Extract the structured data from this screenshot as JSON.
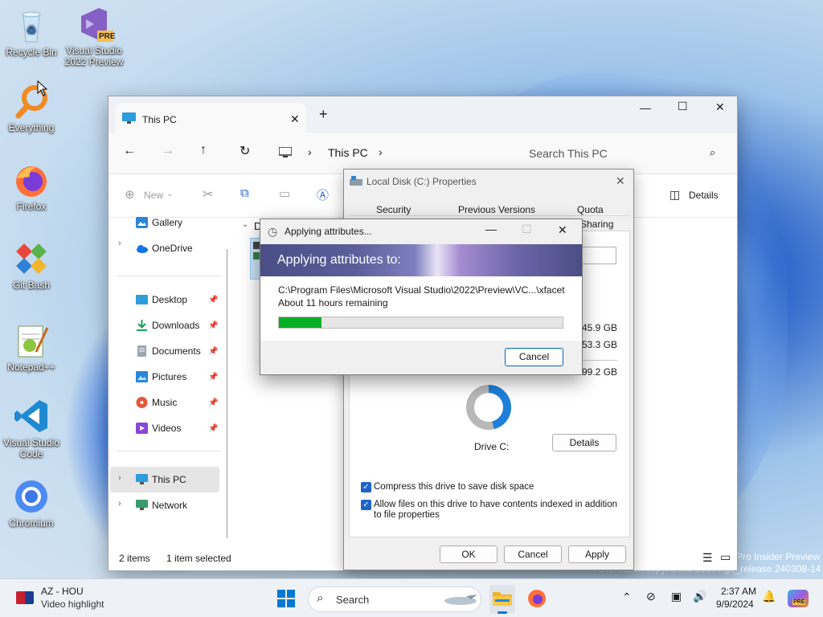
{
  "desktop": {
    "icons": [
      {
        "label": "Recycle Bin"
      },
      {
        "label": "Visual Studio 2022 Preview"
      },
      {
        "label": "Everything"
      },
      {
        "label": "Firefox"
      },
      {
        "label": "Git Bash"
      },
      {
        "label": "Notepad++"
      },
      {
        "label": "Visual Studio Code"
      },
      {
        "label": "Chromium"
      }
    ],
    "watermark": {
      "line1": "Pro Insider Preview",
      "line2": "Evaluation copy. Build 26100.ge_release.240308-1400"
    },
    "vs_badge": "PRE"
  },
  "explorer": {
    "tab_title": "This PC",
    "new_tab": "+",
    "address": "This PC",
    "search_placeholder": "Search This PC",
    "cmd_new": "New",
    "details": "Details",
    "nav": {
      "gallery": "Gallery",
      "onedrive": "OneDrive",
      "desktop": "Desktop",
      "downloads": "Downloads",
      "documents": "Documents",
      "pictures": "Pictures",
      "music": "Music",
      "videos": "Videos",
      "thispc": "This PC",
      "network": "Network"
    },
    "section_letter": "D",
    "status_items": "2 items",
    "status_selected": "1 item selected"
  },
  "properties": {
    "title": "Local Disk (C:) Properties",
    "tabs": {
      "security": "Security",
      "previous_versions": "Previous Versions",
      "quota": "Quota",
      "sharing": "Sharing"
    },
    "sizes": {
      "used": "45.9 GB",
      "free": "53.3 GB",
      "capacity": "99.2 GB"
    },
    "drive_label": "Drive C:",
    "details_btn": "Details",
    "compress": "Compress this drive to save disk space",
    "index": "Allow files on this drive to have contents indexed in addition to file properties",
    "ok": "OK",
    "cancel": "Cancel",
    "apply": "Apply",
    "colors": {
      "used": "#1e7fd8",
      "free": "#b8b8b8"
    },
    "used_fraction": 0.46
  },
  "apply_dialog": {
    "title": "Applying attributes...",
    "banner": "Applying attributes to:",
    "path": "C:\\Program Files\\Microsoft Visual Studio\\2022\\Preview\\VC...\\xfacet",
    "remaining": "About 11 hours remaining",
    "progress": 0.15,
    "cancel": "Cancel"
  },
  "taskbar": {
    "news_title": "AZ - HOU",
    "news_sub": "Video highlight",
    "search": "Search",
    "time": "2:37 AM",
    "date": "9/9/2024",
    "tray_badge": "PRE"
  }
}
